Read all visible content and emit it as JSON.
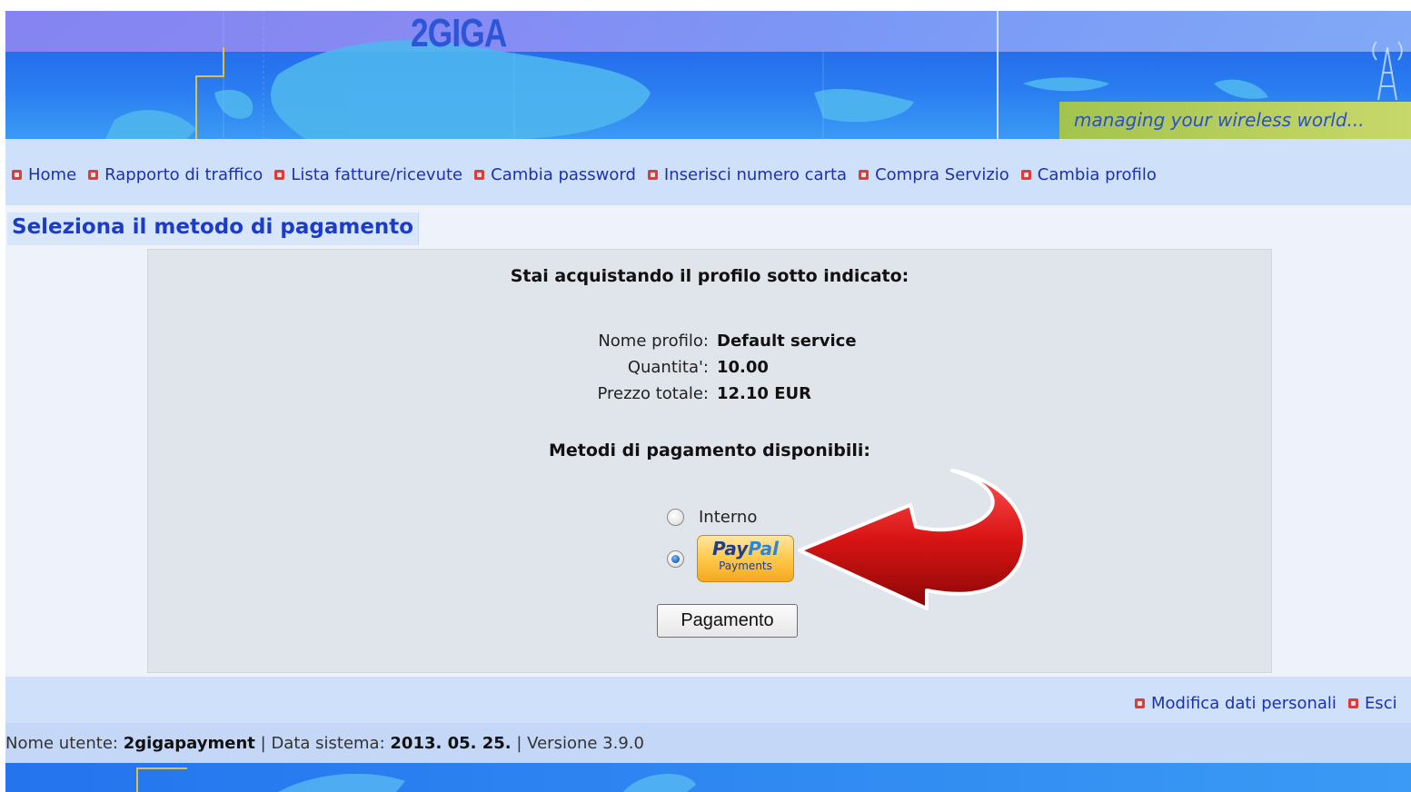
{
  "banner": {
    "logo": "2GIGA",
    "tagline": "managing your wireless world..."
  },
  "nav": {
    "items": [
      {
        "label": "Home"
      },
      {
        "label": "Rapporto di traffico"
      },
      {
        "label": "Lista fatture/ricevute"
      },
      {
        "label": "Cambia password"
      },
      {
        "label": "Inserisci numero carta"
      },
      {
        "label": "Compra Servizio"
      },
      {
        "label": "Cambia profilo"
      }
    ]
  },
  "page": {
    "title": "Seleziona il metodo di pagamento"
  },
  "purchase": {
    "heading": "Stai acquistando il profilo sotto indicato:",
    "profile_label": "Nome profilo:",
    "profile_value": "Default service",
    "quantity_label": "Quantita':",
    "quantity_value": "10.00",
    "total_label": "Prezzo totale:",
    "total_value": "12.10 EUR"
  },
  "payment": {
    "heading": "Metodi di pagamento disponibili:",
    "options": [
      {
        "label": "Interno",
        "selected": false
      },
      {
        "label": "PayPal Payments",
        "selected": true
      }
    ],
    "paypal_word_1": "Pay",
    "paypal_word_2": "Pal",
    "paypal_sub": "Payments",
    "submit_label": "Pagamento"
  },
  "footer": {
    "links": [
      {
        "label": "Modifica dati personali"
      },
      {
        "label": "Esci"
      }
    ],
    "status": {
      "user_label": "Nome utente:",
      "user_value": "2gigapayment",
      "date_label": "Data sistema:",
      "date_value": "2013. 05. 25.",
      "version_label": "Versione 3.9.0"
    }
  },
  "colors": {
    "link": "#1c31b0",
    "title": "#1c3cc8",
    "bullet": "#e23a3a",
    "arrow": "#d01818"
  }
}
